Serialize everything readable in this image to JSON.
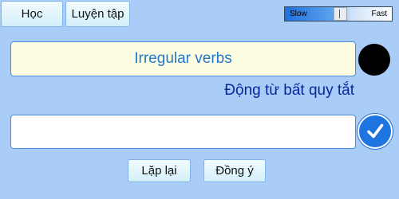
{
  "tabs": {
    "learn_label": "Học",
    "practice_label": "Luyện tập"
  },
  "speed": {
    "slow_label": "Slow",
    "fast_label": "Fast",
    "level": 0.5
  },
  "exercise": {
    "word": "Irregular verbs",
    "meaning": "Động từ bất quy tắt",
    "answer_value": "",
    "status_color": "#000000"
  },
  "icons": {
    "status": "status-indicator",
    "check": "check-icon"
  },
  "actions": {
    "repeat_label": "Lặp lại",
    "ok_label": "Đồng ý"
  },
  "colors": {
    "background": "#a9cdf7",
    "accent": "#1e74e0",
    "word_text": "#2278cc",
    "meaning_text": "#0b27a0"
  }
}
